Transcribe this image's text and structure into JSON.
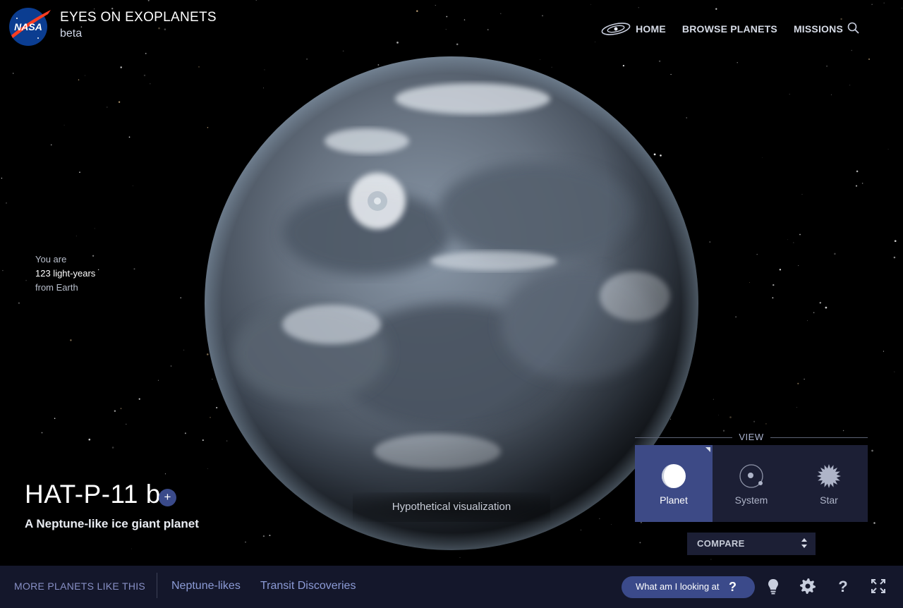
{
  "header": {
    "logo_text": "NASA",
    "title": "EYES ON EXOPLANETS",
    "subtitle": "beta",
    "nav": [
      {
        "label": "HOME"
      },
      {
        "label": "BROWSE PLANETS"
      },
      {
        "label": "MISSIONS"
      }
    ]
  },
  "distance": {
    "line1": "You are",
    "line2": "123 light-years",
    "line3": "from Earth"
  },
  "planet": {
    "name": "HAT-P-11 b",
    "add_symbol": "+",
    "description": "A Neptune-like ice giant planet"
  },
  "visualization_note": "Hypothetical visualization",
  "view": {
    "title": "VIEW",
    "tabs": [
      {
        "label": "Planet",
        "icon": "planet-icon",
        "active": true
      },
      {
        "label": "System",
        "icon": "system-icon",
        "active": false
      },
      {
        "label": "Star",
        "icon": "star-icon",
        "active": false
      }
    ]
  },
  "compare": {
    "label": "COMPARE"
  },
  "footer": {
    "more_label": "MORE PLANETS LIKE THIS",
    "links": [
      "Neptune-likes",
      "Transit Discoveries"
    ],
    "what_label": "What am I looking at",
    "what_symbol": "?",
    "icons": [
      "lightbulb-icon",
      "gear-icon",
      "help-icon",
      "fullscreen-icon"
    ]
  },
  "colors": {
    "accent": "#3b4a8a",
    "active_tab": "#3d4a86",
    "panel": "#1c1f35",
    "footer_bg": "#14172b",
    "link": "#8c9bd6"
  }
}
